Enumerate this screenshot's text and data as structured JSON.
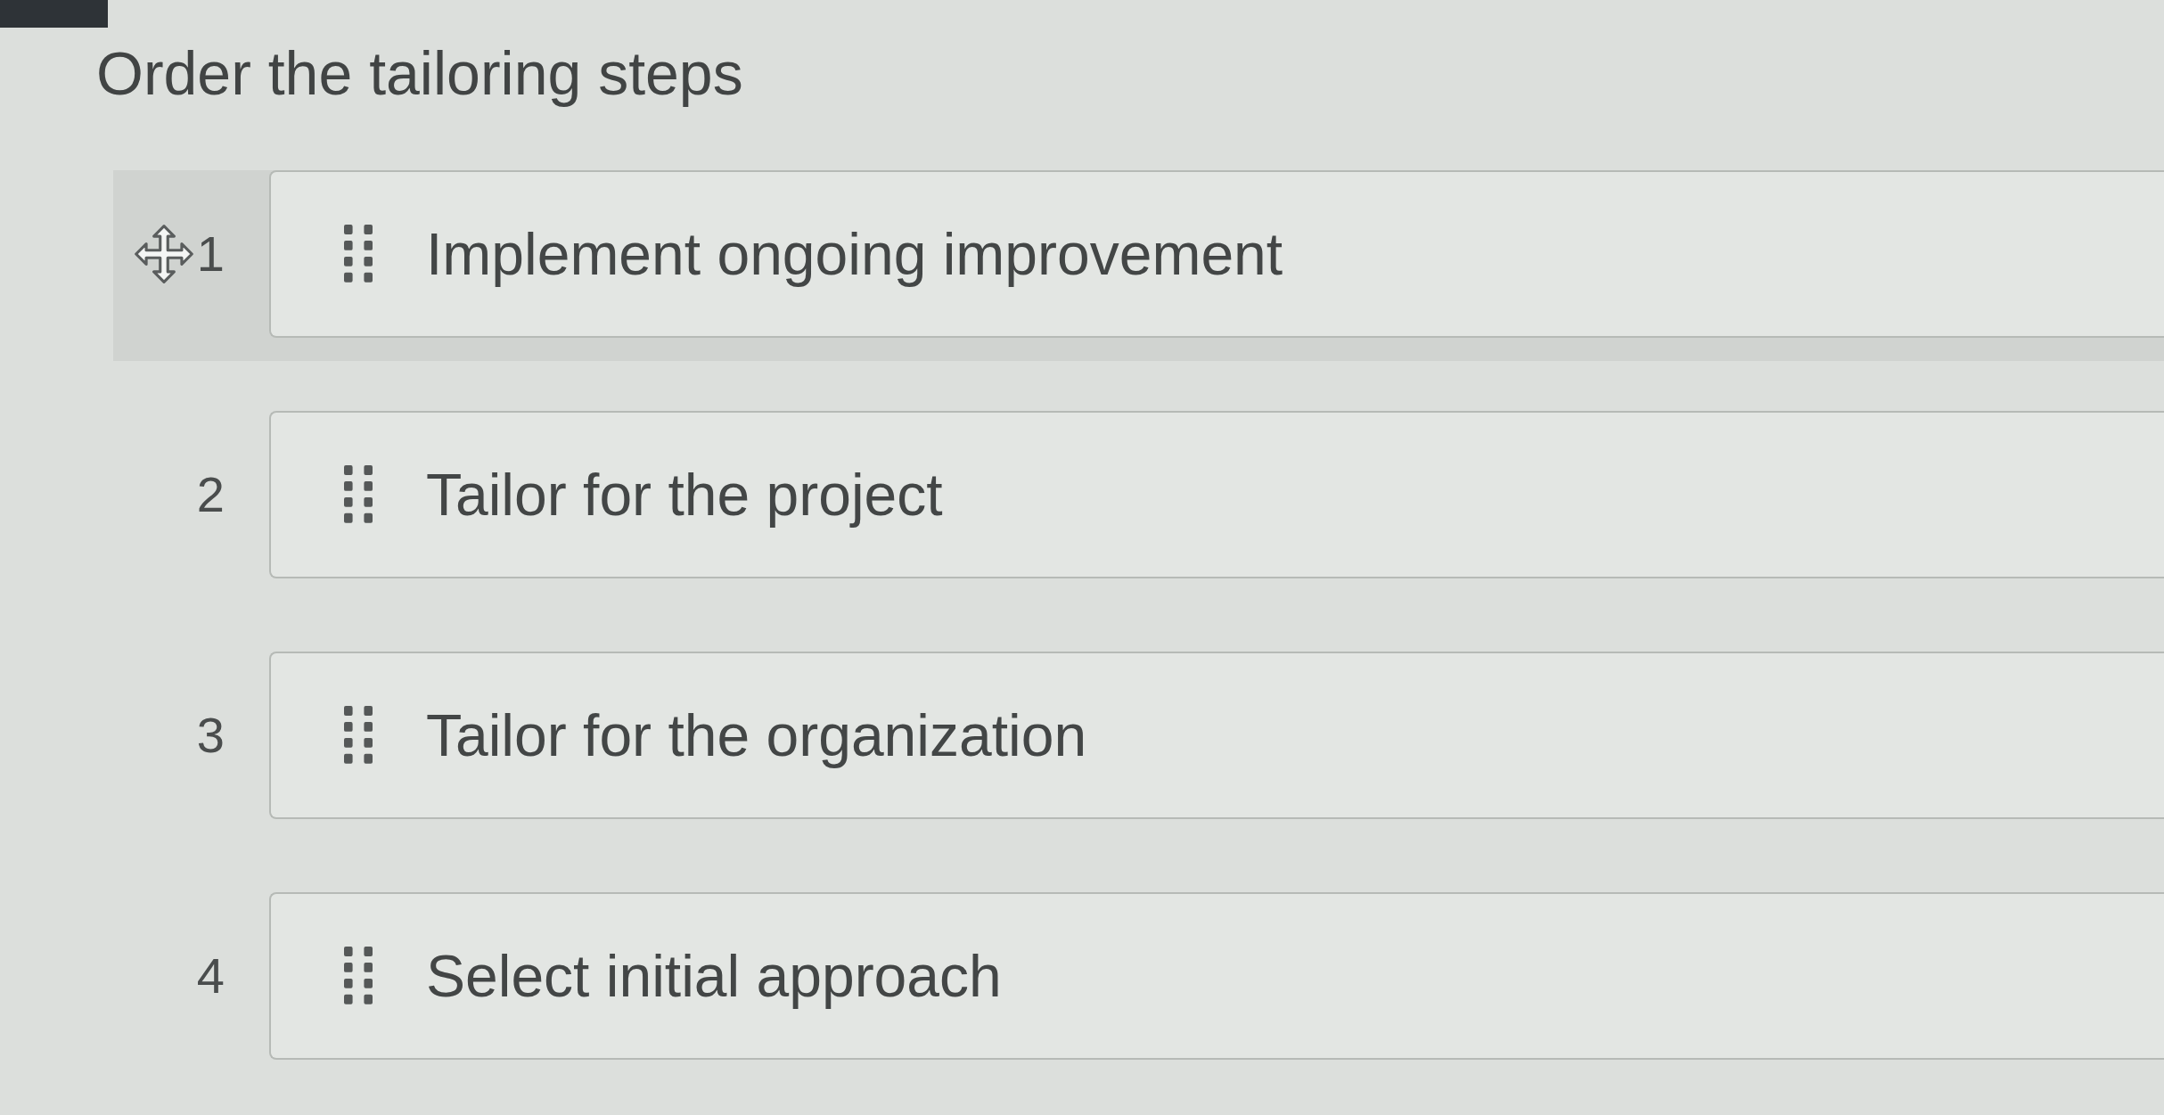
{
  "title": "Order the tailoring steps",
  "items": [
    {
      "number": "1",
      "label": "Implement ongoing improvement",
      "hovered": true
    },
    {
      "number": "2",
      "label": "Tailor for the project",
      "hovered": false
    },
    {
      "number": "3",
      "label": "Tailor for the organization",
      "hovered": false
    },
    {
      "number": "4",
      "label": "Select initial approach",
      "hovered": false
    }
  ]
}
